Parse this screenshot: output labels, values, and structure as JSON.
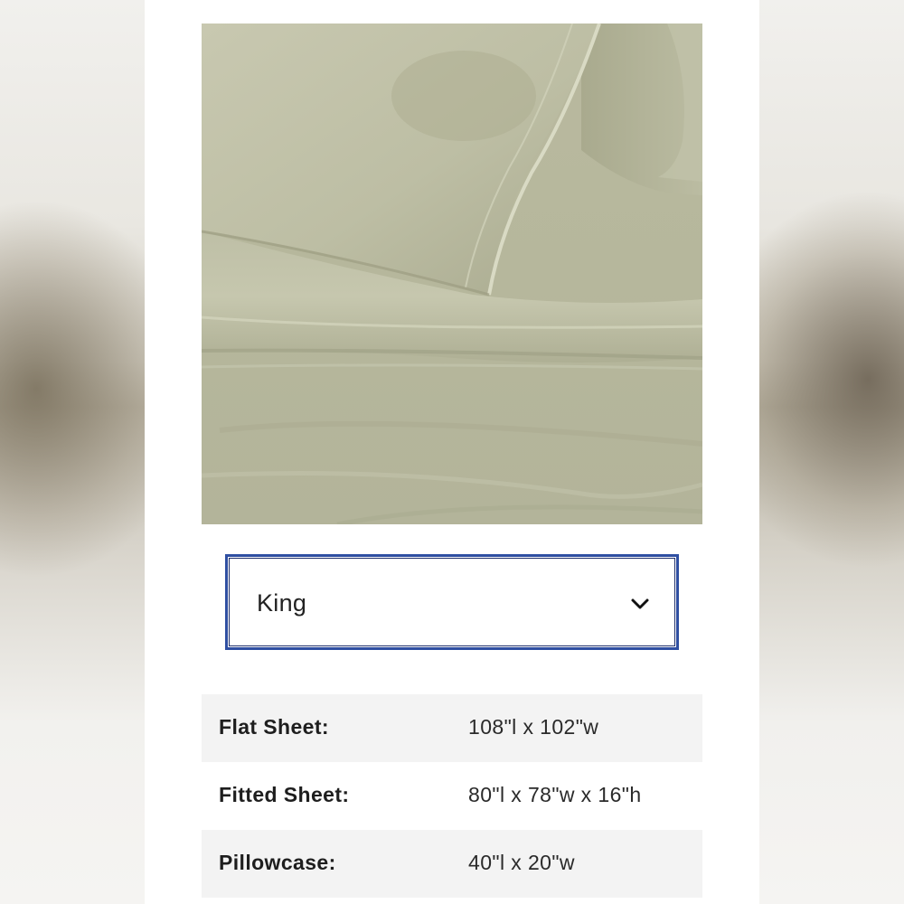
{
  "size_select": {
    "selected": "King",
    "icon": "chevron-down-icon"
  },
  "specs": [
    {
      "label": "Flat Sheet:",
      "value": "108\"l x 102\"w"
    },
    {
      "label": "Fitted Sheet:",
      "value": "80\"l x 78\"w x 16\"h"
    },
    {
      "label": "Pillowcase:",
      "value": "40\"l x 20\"w"
    }
  ],
  "colors": {
    "select_border": "#2f4fa2",
    "sheet": "#bcbda4",
    "row_shade": "#f3f3f3"
  }
}
